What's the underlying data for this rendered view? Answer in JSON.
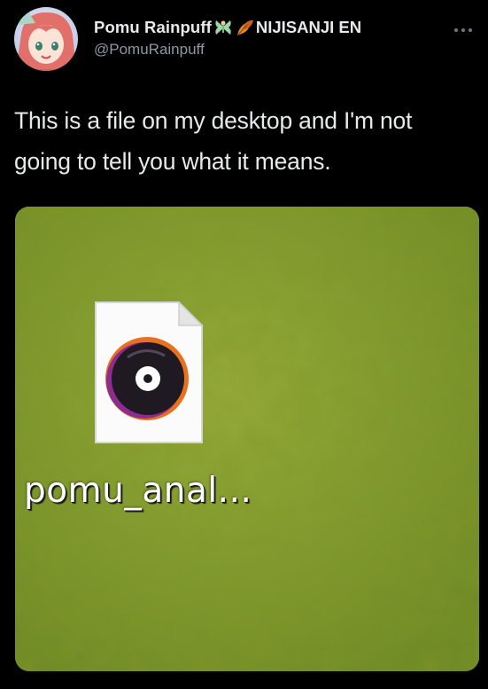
{
  "tweet": {
    "author": {
      "display_name": "Pomu Rainpuff",
      "affiliation": "NIJISANJI EN",
      "handle": "@PomuRainpuff",
      "name_emojis": [
        "fairy-emoji",
        "leaf-emoji"
      ]
    },
    "more_icon": "more-horizontal-icon",
    "text_lines": [
      "This is a file on my desktop and I'm not",
      "going to tell you what it means."
    ],
    "media": {
      "desktop_background_color": "#7f9a2e",
      "file": {
        "label": "pomu_anal...",
        "icon": "audio-file-icon"
      }
    }
  }
}
